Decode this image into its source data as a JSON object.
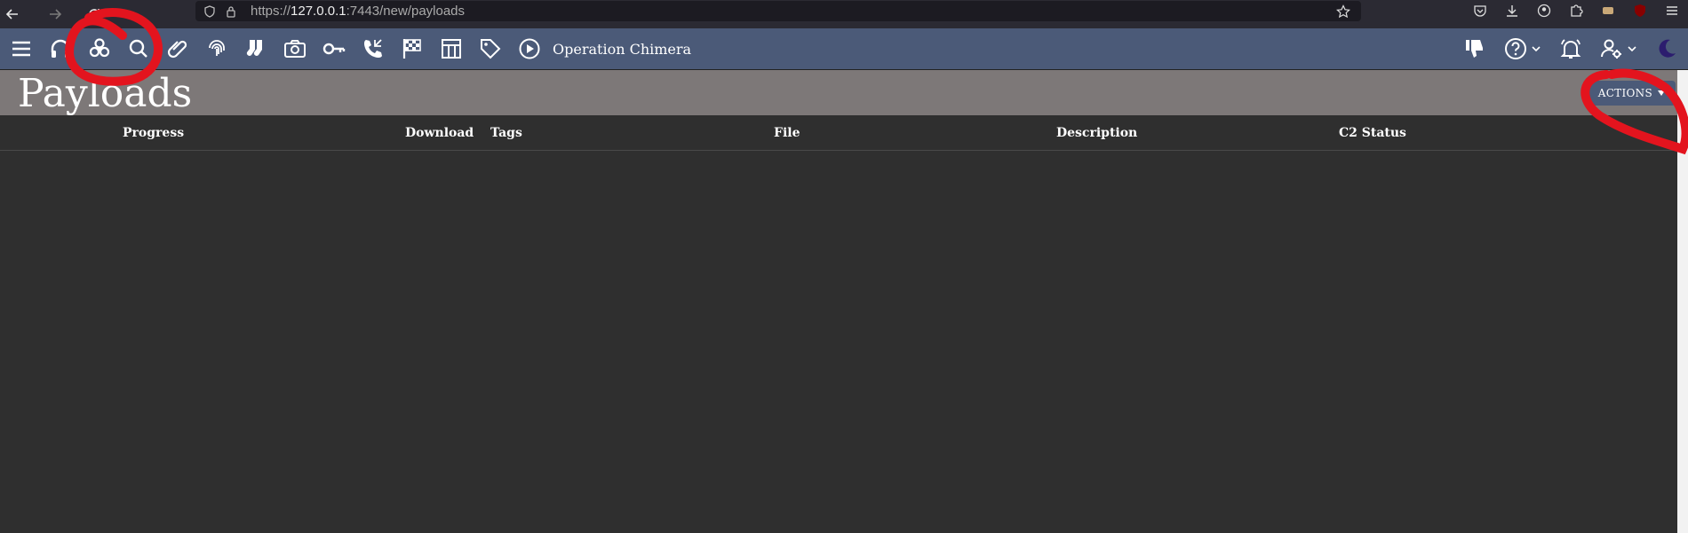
{
  "browser": {
    "url_scheme": "https://",
    "url_host": "127.0.0.1",
    "url_rest": ":7443/new/payloads"
  },
  "toolbar": {
    "operation_name": "Operation Chimera",
    "icons": [
      "hamburger-menu-icon",
      "headphones-icon",
      "biohazard-icon",
      "search-icon",
      "paperclip-icon",
      "fingerprint-icon",
      "socks-icon",
      "camera-icon",
      "key-icon",
      "phone-incoming-icon",
      "checkered-flag-icon",
      "table-icon",
      "tag-icon",
      "play-circle-icon"
    ]
  },
  "page": {
    "title": "Payloads",
    "actions_label": "ACTIONS"
  },
  "table": {
    "columns": {
      "progress": "Progress",
      "download": "Download",
      "tags": "Tags",
      "file": "File",
      "description": "Description",
      "c2status": "C2 Status"
    }
  },
  "colors": {
    "toolbar": "#4b5a78",
    "header": "#7d7878",
    "body": "#2f2f2f",
    "annotation": "#e3141e"
  }
}
